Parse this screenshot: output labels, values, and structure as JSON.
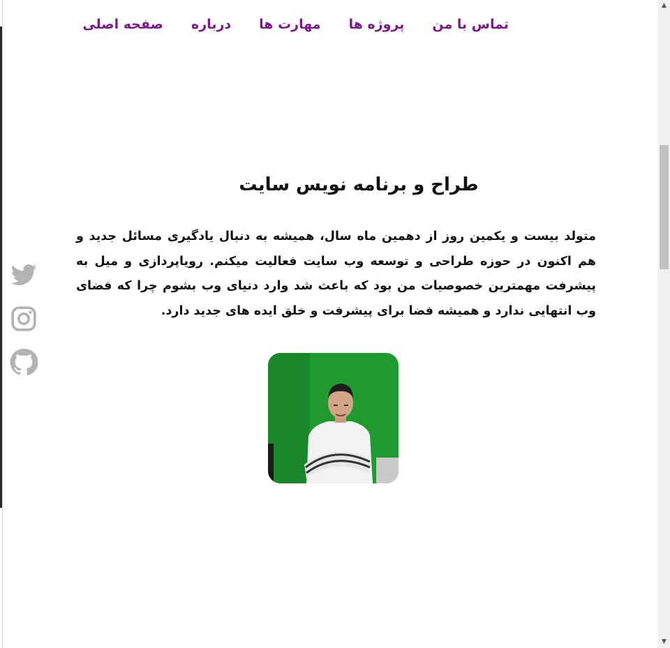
{
  "nav": {
    "items": [
      "صفحه اصلی",
      "درباره",
      "مهارت ها",
      "پروژه ها",
      "تماس با من"
    ]
  },
  "hero": {
    "headline": "طراح و برنامه نویس سایت",
    "bio": "متولد بیست و یکمین روز از دهمین ماه سال، همیشه به دنبال یادگیری مسائل جدید و هم اکنون در حوزه طراحی و توسعه وب سایت فعالیت میکنم. رویاپردازی و میل به پیشرفت مهمترین خصوصیات من بود که باعث شد وارد دنیای وب بشوم چرا که فضای وب انتهایی ندارد و همیشه فضا برای پیشرفت و خلق ایده های جدید دارد."
  },
  "social": {
    "icons": [
      "twitter-icon",
      "instagram-icon",
      "github-icon"
    ],
    "icon_color": "#b3b3b3"
  },
  "colors": {
    "nav_link": "#7b1b87",
    "text": "#111111",
    "photo_background": "#1f9a2f"
  }
}
